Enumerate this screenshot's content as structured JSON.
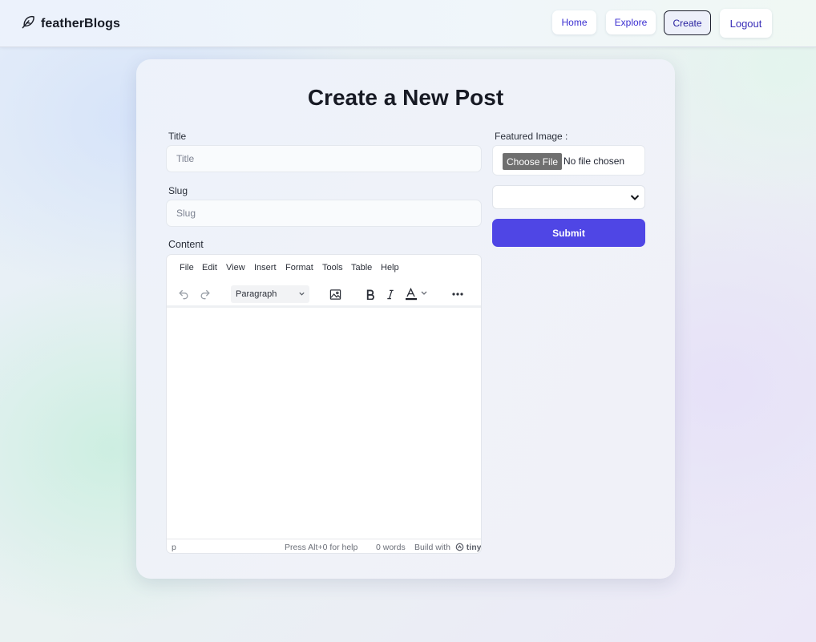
{
  "nav": {
    "brand": "featherBlogs",
    "brand_icon": "feather-icon",
    "links": {
      "home": "Home",
      "explore": "Explore",
      "create": "Create",
      "logout": "Logout"
    },
    "active": "Create"
  },
  "form": {
    "heading": "Create a New Post",
    "title_label": "Title",
    "title_placeholder": "Title",
    "slug_label": "Slug",
    "slug_placeholder": "Slug",
    "content_label": "Content",
    "featured_image_label": "Featured Image :",
    "choose_file_label": "Choose File",
    "no_file_text": "No file chosen",
    "status_select_value": "",
    "submit_label": "Submit"
  },
  "editor": {
    "menu": [
      "File",
      "Edit",
      "View",
      "Insert",
      "Format",
      "Tools",
      "Table",
      "Help"
    ],
    "block_format": "Paragraph",
    "toolbar_icons": [
      "undo-icon",
      "redo-icon",
      "image-icon",
      "bold-icon",
      "italic-icon",
      "text-color-icon",
      "more-icon"
    ],
    "status": {
      "path": "p",
      "help": "Press Alt+0 for help",
      "word_count": "0 words",
      "build_with": "Build with",
      "brand": "tiny"
    }
  },
  "colors": {
    "accent": "#4f46e5",
    "nav_link": "#3b2fd1",
    "heading": "#171a24"
  }
}
